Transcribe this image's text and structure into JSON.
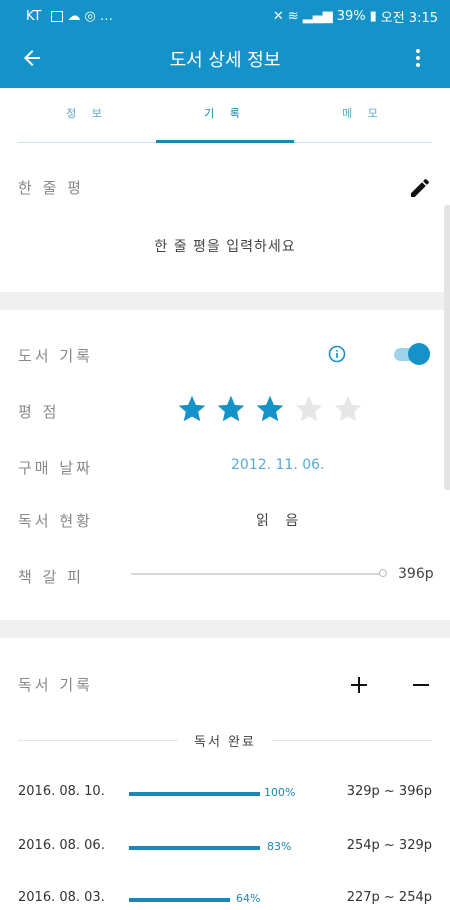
{
  "status_bar": {
    "carrier": "KT",
    "battery": "39%",
    "time": "오전 3:15"
  },
  "app_bar": {
    "title": "도서 상세 정보"
  },
  "tabs": [
    {
      "label": "정 보",
      "active": false
    },
    {
      "label": "기 록",
      "active": true
    },
    {
      "label": "메 모",
      "active": false
    }
  ],
  "review": {
    "label": "한 줄 평",
    "placeholder": "한 줄 평을 입력하세요"
  },
  "book_record": {
    "label": "도서 기록",
    "toggle_on": true,
    "rating_label": "평 점",
    "rating": 3,
    "rating_max": 5,
    "purchase_label": "구매 날짜",
    "purchase_date": "2012. 11. 06.",
    "status_label": "독서 현황",
    "status_value": "읽 음",
    "bookmark_label": "책 갈 피",
    "bookmark_pages": "396p",
    "bookmark_progress": 1.0
  },
  "reading_log": {
    "label": "독서 기록",
    "divider": "독서 완료",
    "entries": [
      {
        "date": "2016. 08. 10.",
        "percent": "100%",
        "range": "329p ~ 396p"
      },
      {
        "date": "2016. 08. 06.",
        "percent": "83%",
        "range": "254p ~ 329p"
      },
      {
        "date": "2016. 08. 03.",
        "percent": "64%",
        "range": "227p ~ 254p"
      }
    ]
  },
  "colors": {
    "primary": "#1592c8",
    "accent": "#1d86b8",
    "star_empty": "#e6e6e6"
  }
}
